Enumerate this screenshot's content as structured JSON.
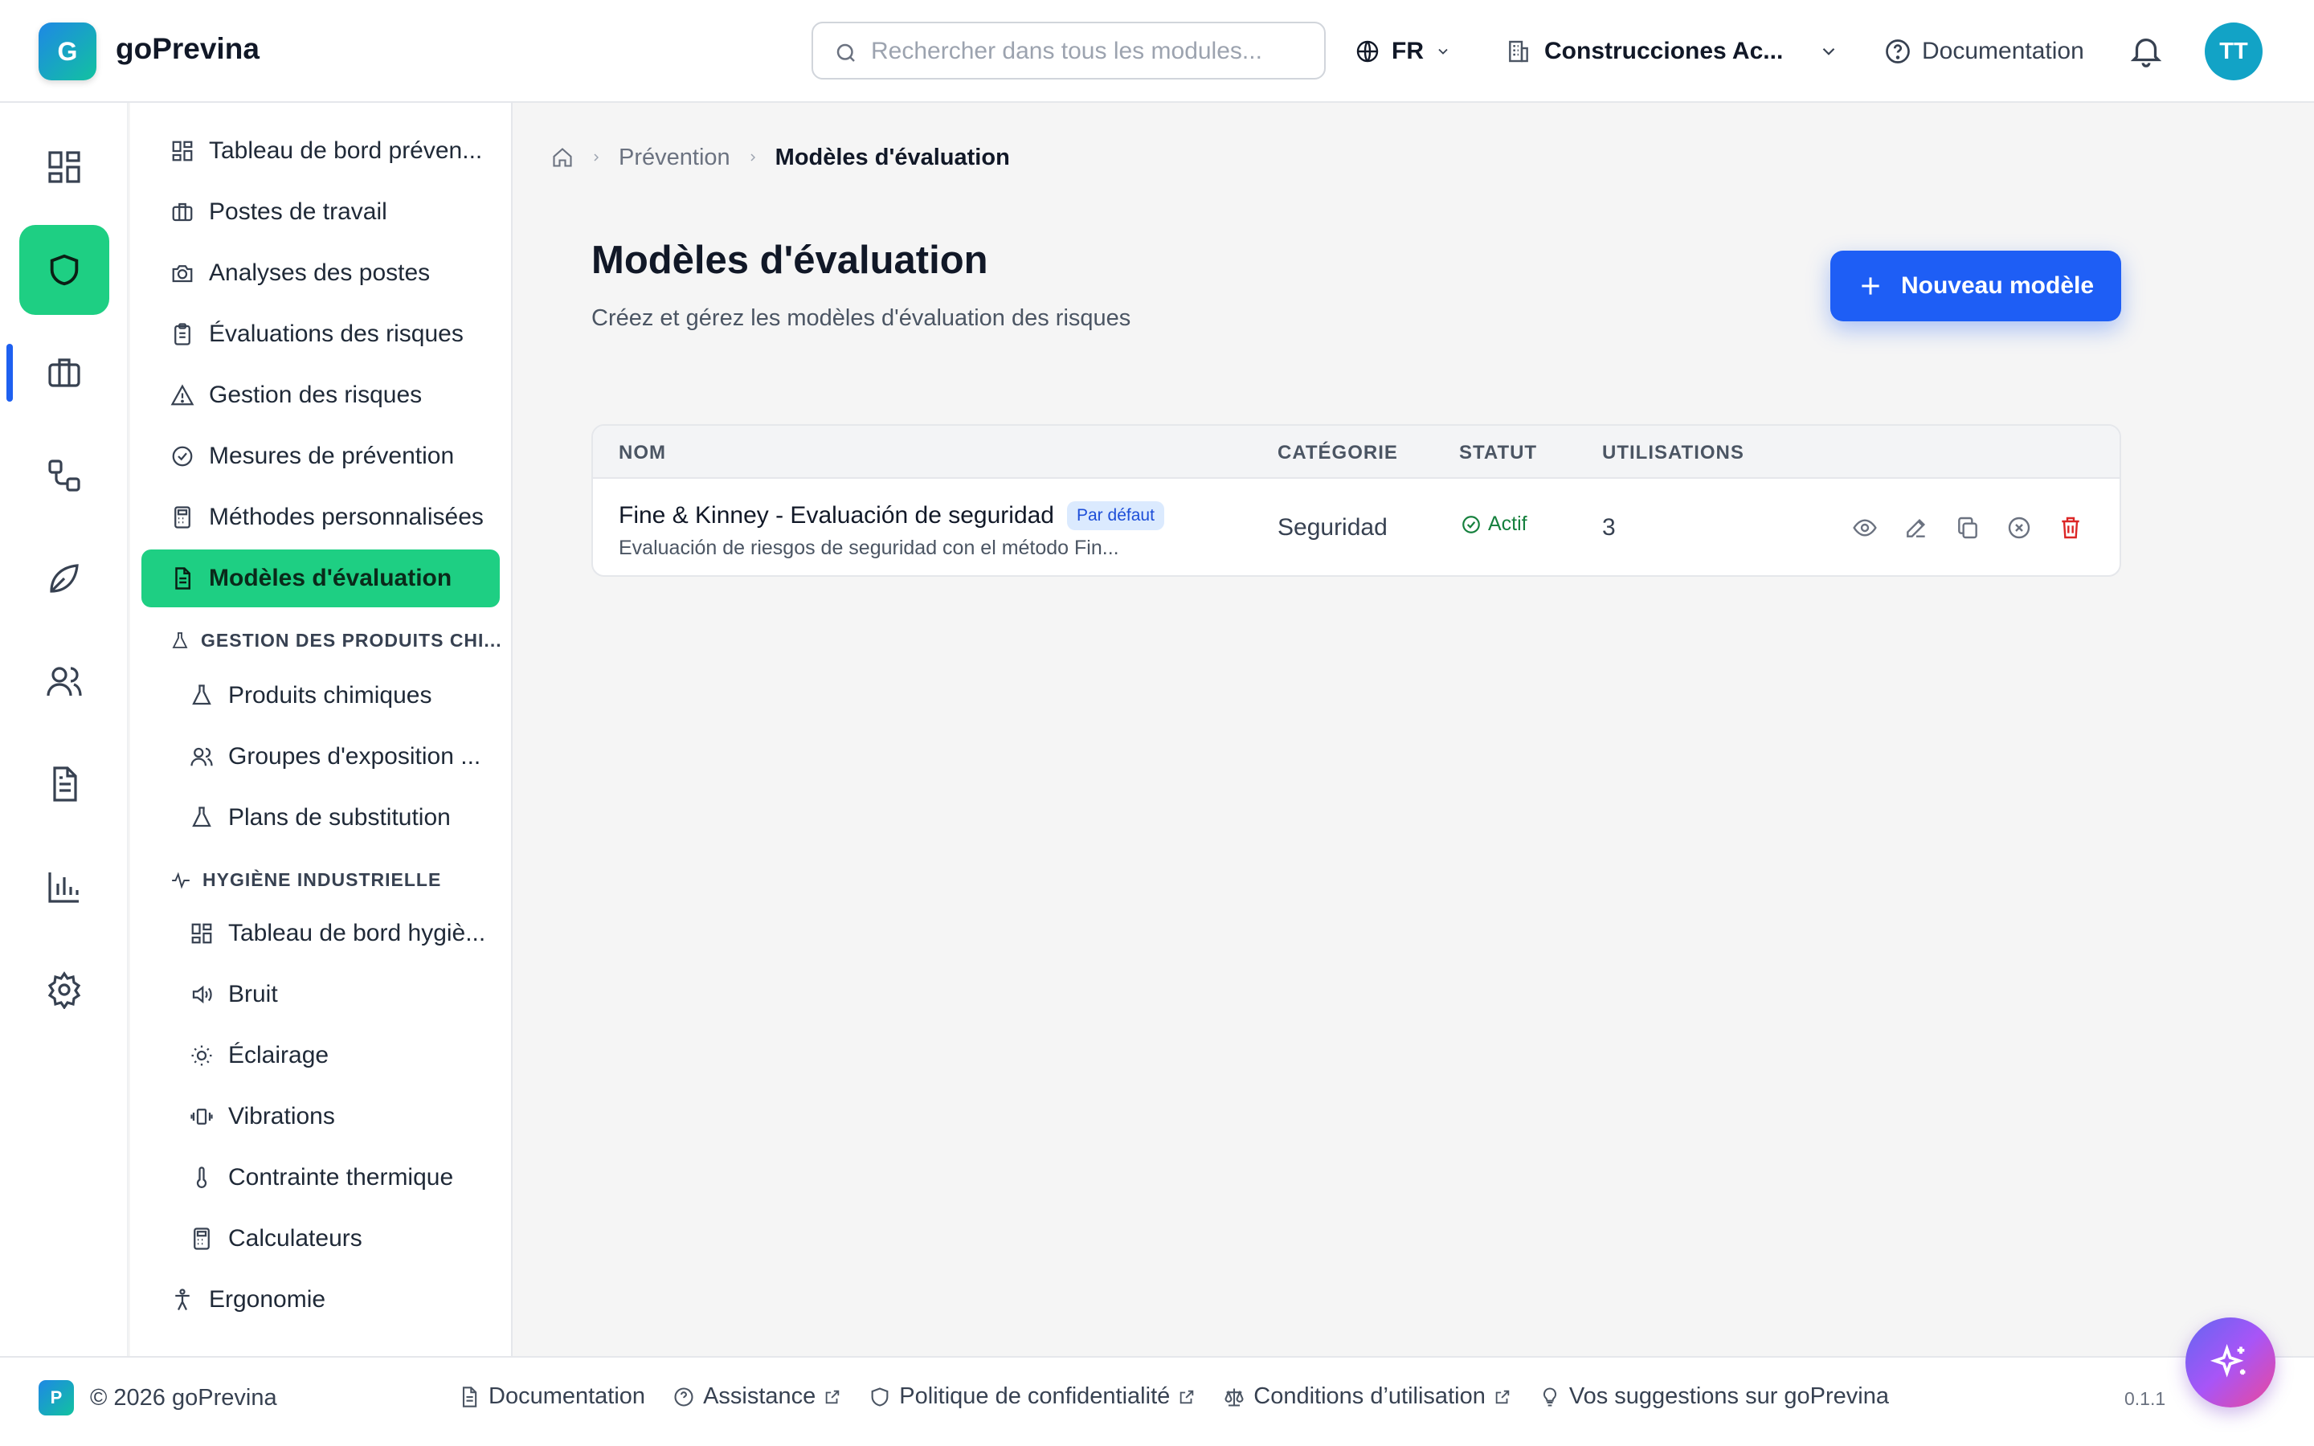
{
  "header": {
    "logo_letter": "G",
    "app_name": "goPrevina",
    "search_placeholder": "Rechercher dans tous les modules...",
    "language": "FR",
    "company": "Construcciones Ac...",
    "documentation": "Documentation",
    "avatar_initials": "TT"
  },
  "rail": {
    "items": [
      {
        "icon": "dashboard-icon"
      },
      {
        "icon": "shield-icon",
        "active": true
      },
      {
        "icon": "briefcase-icon"
      },
      {
        "icon": "workflow-icon"
      },
      {
        "icon": "leaf-icon"
      },
      {
        "icon": "users-icon"
      },
      {
        "icon": "document-icon"
      },
      {
        "icon": "bar-chart-icon"
      },
      {
        "icon": "gear-icon"
      }
    ]
  },
  "sidebar": {
    "items": [
      {
        "label": "Tableau de bord préven...",
        "icon": "dashboard-icon"
      },
      {
        "label": "Postes de travail",
        "icon": "briefcase-icon"
      },
      {
        "label": "Analyses des postes",
        "icon": "camera-icon"
      },
      {
        "label": "Évaluations des risques",
        "icon": "clipboard-icon"
      },
      {
        "label": "Gestion des risques",
        "icon": "warning-icon"
      },
      {
        "label": "Mesures de prévention",
        "icon": "check-circle-icon"
      },
      {
        "label": "Méthodes personnalisées",
        "icon": "calculator-icon"
      },
      {
        "label": "Modèles d'évaluation",
        "icon": "file-text-icon",
        "active": true
      }
    ],
    "chem_section": {
      "title": "GESTION DES PRODUITS CHI...",
      "items": [
        {
          "label": "Produits chimiques",
          "icon": "flask-icon"
        },
        {
          "label": "Groupes d'exposition ...",
          "icon": "users-icon"
        },
        {
          "label": "Plans de substitution",
          "icon": "flask-icon"
        }
      ]
    },
    "hygiene_section": {
      "title": "HYGIÈNE INDUSTRIELLE",
      "items": [
        {
          "label": "Tableau de bord hygiè...",
          "icon": "dashboard-icon"
        },
        {
          "label": "Bruit",
          "icon": "speaker-icon"
        },
        {
          "label": "Éclairage",
          "icon": "sun-icon"
        },
        {
          "label": "Vibrations",
          "icon": "vibration-icon"
        },
        {
          "label": "Contrainte thermique",
          "icon": "thermometer-icon"
        },
        {
          "label": "Calculateurs",
          "icon": "calculator-icon"
        }
      ]
    },
    "bottom_items": [
      {
        "label": "Ergonomie",
        "icon": "person-icon"
      }
    ]
  },
  "breadcrumb": {
    "parent": "Prévention",
    "current": "Modèles d'évaluation"
  },
  "main": {
    "title": "Modèles d'évaluation",
    "subtitle": "Créez et gérez les modèles d'évaluation des risques",
    "new_button": "Nouveau modèle"
  },
  "table": {
    "headers": {
      "name": "NOM",
      "category": "CATÉGORIE",
      "status": "STATUT",
      "uses": "UTILISATIONS"
    },
    "rows": [
      {
        "name": "Fine & Kinney - Evaluación de seguridad",
        "badge": "Par défaut",
        "description": "Evaluación de riesgos de seguridad con el método Fin...",
        "category": "Seguridad",
        "status": "Actif",
        "uses": "3"
      }
    ]
  },
  "footer": {
    "logo_letter": "P",
    "copyright": "© 2026 goPrevina",
    "links": {
      "documentation": "Documentation",
      "assistance": "Assistance",
      "privacy": "Politique de confidentialité",
      "terms": "Conditions d’utilisation",
      "suggestions": "Vos suggestions sur goPrevina"
    },
    "version": "0.1.1"
  },
  "colors": {
    "accent_green": "#1ecf83",
    "primary_blue": "#1e5ef5",
    "danger_red": "#dc2626",
    "success_green": "#15803d"
  }
}
